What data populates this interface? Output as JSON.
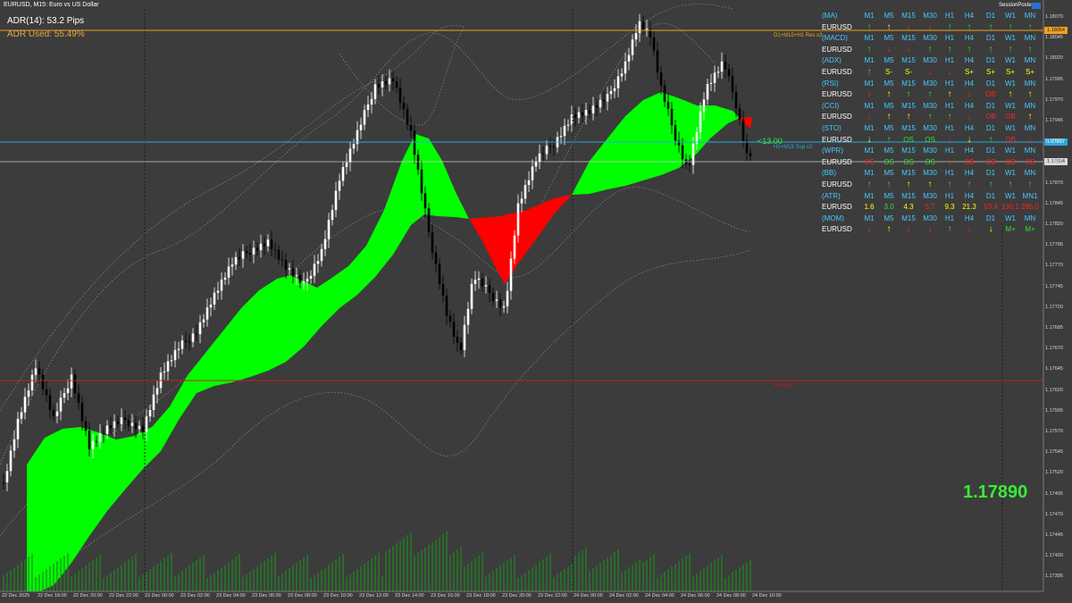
{
  "window": {
    "title": "EURUSD, M15:  Euro vs US Dollar",
    "adr_text": "ADR(14): 53.2 Pips",
    "adr_used_text": "ADR Used: 55.49%",
    "big_price": "1.17890",
    "session_poster": "SessionPoster"
  },
  "colors": {
    "background": "#3c3c3c",
    "bull_band": "#00ff00",
    "bear_band": "#ff0000",
    "resistance_line": "#f0a020",
    "support_line": "#29a9e0",
    "h4_line": "#cc1a1a",
    "up_arrow": "#2ee02e",
    "down_arrow": "#ff2020",
    "neutral_arrow": "#ffff00",
    "header_text": "#46c9ff"
  },
  "levels": {
    "resistance_label": "D1+M15+H1 Res x3",
    "support_label": "H1+M15 Sup x2",
    "support_marker": "<13.00",
    "h4_label": "H4 Sup",
    "resistance_tag": "1.18054",
    "support_tag": "1.17917",
    "current_tag": "1.17894"
  },
  "price_axis": [
    "1.18070",
    "1.18045",
    "1.18020",
    "1.17995",
    "1.17970",
    "1.17945",
    "1.17920",
    "1.17895",
    "1.17870",
    "1.17845",
    "1.17820",
    "1.17795",
    "1.17770",
    "1.17745",
    "1.17720",
    "1.17695",
    "1.17670",
    "1.17645",
    "1.17620",
    "1.17595",
    "1.17570",
    "1.17545",
    "1.17520",
    "1.17495",
    "1.17470",
    "1.17445",
    "1.17420",
    "1.17395"
  ],
  "time_axis": [
    "22 Dec 2025",
    "22 Dec 18:00",
    "22 Dec 20:00",
    "22 Dec 22:00",
    "23 Dec 00:00",
    "23 Dec 02:00",
    "23 Dec 04:00",
    "23 Dec 06:00",
    "23 Dec 08:00",
    "23 Dec 10:00",
    "23 Dec 12:00",
    "23 Dec 14:00",
    "23 Dec 16:00",
    "23 Dec 18:00",
    "23 Dec 20:00",
    "23 Dec 22:00",
    "24 Dec 00:00",
    "24 Dec 02:00",
    "24 Dec 04:00",
    "24 Dec 06:00",
    "24 Dec 08:00",
    "24 Dec 10:00"
  ],
  "panel": {
    "timeframes": [
      "M1",
      "M5",
      "M15",
      "M30",
      "H1",
      "H4",
      "D1",
      "W1",
      "MN"
    ],
    "symbol": "EURUSD",
    "indicators": [
      {
        "name": "(MA)",
        "tf_last": "MN",
        "signals": [
          [
            "up",
            "g"
          ],
          [
            "up",
            "y"
          ],
          [
            "down",
            "r"
          ],
          [
            "down",
            "r"
          ],
          [
            "up",
            "g"
          ],
          [
            "up",
            "g"
          ],
          [
            "up",
            "g"
          ],
          [
            "up",
            "g"
          ],
          [
            "up",
            "g"
          ]
        ]
      },
      {
        "name": "(MACD)",
        "tf_last": "MN",
        "signals": [
          [
            "up",
            "g"
          ],
          [
            "down",
            "r"
          ],
          [
            "down",
            "r"
          ],
          [
            "up",
            "g"
          ],
          [
            "up",
            "g"
          ],
          [
            "up",
            "g"
          ],
          [
            "up",
            "g"
          ],
          [
            "up",
            "g"
          ],
          [
            "up",
            "g"
          ]
        ]
      },
      {
        "name": "(ADX)",
        "tf_last": "MN",
        "signals": [
          [
            "up",
            "g"
          ],
          [
            "S-",
            "y"
          ],
          [
            "S-",
            "y"
          ],
          [
            "down",
            "r"
          ],
          [
            "down",
            "r"
          ],
          [
            "S+",
            "y"
          ],
          [
            "S+",
            "y"
          ],
          [
            "S+",
            "y"
          ],
          [
            "S+",
            "y"
          ]
        ]
      },
      {
        "name": "(RSI)",
        "tf_last": "MN",
        "signals": [
          [
            "down",
            "r"
          ],
          [
            "up",
            "y"
          ],
          [
            "up",
            "g"
          ],
          [
            "up",
            "g"
          ],
          [
            "up",
            "y"
          ],
          [
            "down",
            "r"
          ],
          [
            "OB",
            "r"
          ],
          [
            "up",
            "y"
          ],
          [
            "up",
            "y"
          ]
        ]
      },
      {
        "name": "(CCI)",
        "tf_last": "MN",
        "signals": [
          [
            "down",
            "r"
          ],
          [
            "up",
            "y"
          ],
          [
            "up",
            "y"
          ],
          [
            "up",
            "g"
          ],
          [
            "up",
            "g"
          ],
          [
            "down",
            "r"
          ],
          [
            "OB",
            "r"
          ],
          [
            "OB",
            "r"
          ],
          [
            "up",
            "y"
          ]
        ]
      },
      {
        "name": "(STO)",
        "tf_last": "MN",
        "signals": [
          [
            "down",
            "y"
          ],
          [
            "up",
            "g"
          ],
          [
            "OS",
            "g"
          ],
          [
            "OS",
            "g"
          ],
          [
            "down",
            "r"
          ],
          [
            "down",
            "y"
          ],
          [
            "up",
            "g"
          ],
          [
            "OB",
            "r"
          ],
          [
            "down",
            "r"
          ]
        ]
      },
      {
        "name": "(WPR)",
        "tf_last": "MN",
        "signals": [
          [
            "OS",
            "r"
          ],
          [
            "OS",
            "g"
          ],
          [
            "OS",
            "g"
          ],
          [
            "OS",
            "g"
          ],
          [
            "down",
            "r"
          ],
          [
            "OB",
            "r"
          ],
          [
            "OB",
            "r"
          ],
          [
            "OB",
            "r"
          ],
          [
            "OB",
            "r"
          ]
        ]
      },
      {
        "name": "(BB)",
        "tf_last": "MN",
        "signals": [
          [
            "up",
            "g"
          ],
          [
            "up",
            "g"
          ],
          [
            "up",
            "y"
          ],
          [
            "up",
            "y"
          ],
          [
            "up",
            "g"
          ],
          [
            "up",
            "g"
          ],
          [
            "up",
            "g"
          ],
          [
            "up",
            "g"
          ],
          [
            "up",
            "g"
          ]
        ]
      },
      {
        "name": "(ATR)",
        "tf_last": "MN1",
        "signals": [
          [
            "1.6",
            "y"
          ],
          [
            "3.0",
            "g"
          ],
          [
            "4.3",
            "y"
          ],
          [
            "5.7",
            "r"
          ],
          [
            "9.3",
            "y"
          ],
          [
            "21.3",
            "y"
          ],
          [
            "53.4",
            "r"
          ],
          [
            "130.1",
            "r"
          ],
          [
            "285.0",
            "r"
          ]
        ]
      },
      {
        "name": "(MOM)",
        "tf_last": "MN",
        "signals": [
          [
            "down",
            "r"
          ],
          [
            "up",
            "y"
          ],
          [
            "down",
            "r"
          ],
          [
            "down",
            "r"
          ],
          [
            "up",
            "g"
          ],
          [
            "down",
            "r"
          ],
          [
            "down",
            "y"
          ],
          [
            "M+",
            "g"
          ],
          [
            "M+",
            "g"
          ]
        ]
      }
    ]
  }
}
